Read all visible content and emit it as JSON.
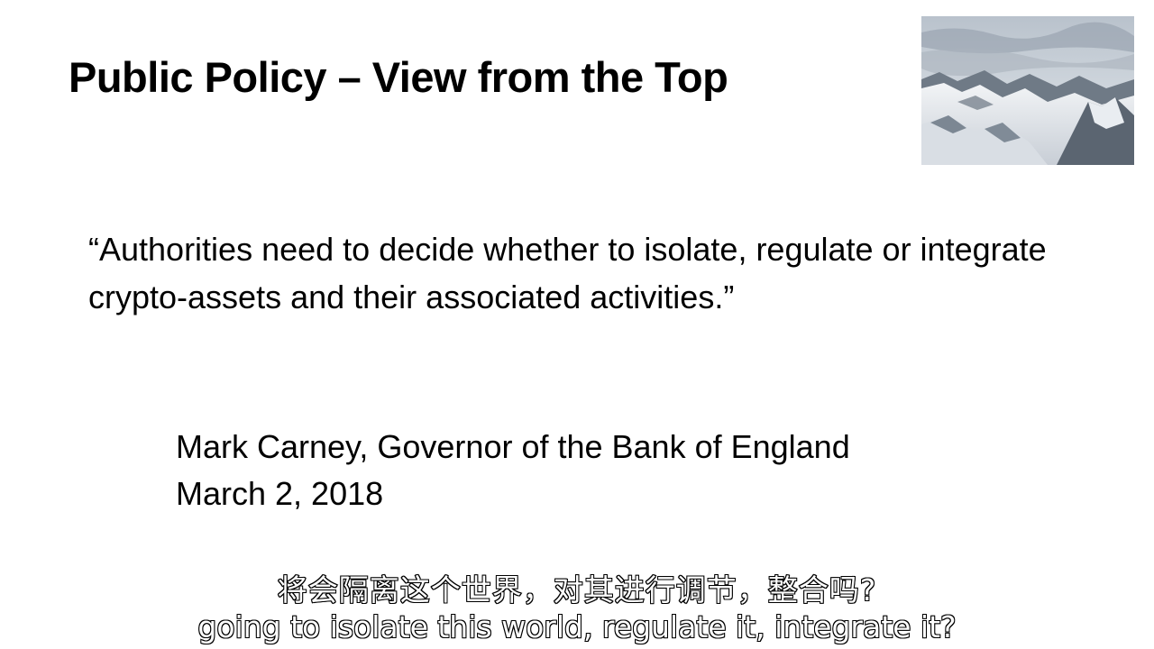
{
  "slide": {
    "title": "Public Policy – View from the Top",
    "quote": "“Authorities need to decide whether to isolate, regulate or integrate crypto-assets and their associated activities.”",
    "attribution": {
      "speaker": "Mark Carney, Governor of the Bank of England",
      "date": "March 2, 2018"
    },
    "image": "mountain-peak-photo"
  },
  "subtitles": {
    "chinese": "将会隔离这个世界，对其进行调节，整合吗?",
    "english": "going to isolate this world, regulate it, integrate it?"
  }
}
